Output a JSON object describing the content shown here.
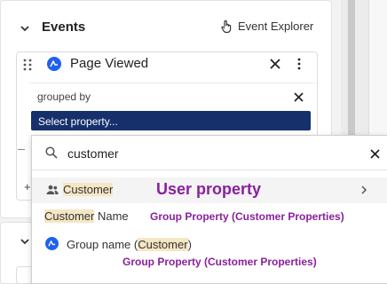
{
  "events_panel": {
    "title": "Events",
    "explorer_label": "Event Explorer",
    "event": {
      "name": "Page Viewed",
      "grouped_by_label": "grouped by",
      "select_property_label": "Select property..."
    },
    "add_label": "+"
  },
  "dropdown": {
    "search_value": "customer",
    "search_placeholder": "",
    "items": [
      {
        "label_match": "Customer",
        "label_rest": "",
        "annotation": "User property",
        "icon": "user-group-icon"
      },
      {
        "label_match": "Customer",
        "label_rest": " Name",
        "annotation": "Group Property (Customer Properties)"
      },
      {
        "label_prefix": "Group name (",
        "label_match": "Customer",
        "label_suffix": ")",
        "annotation": "Group Property (Customer Properties)",
        "icon": "amplitude-icon"
      }
    ]
  },
  "colors": {
    "select_bg": "#15306b",
    "annotation": "#8a1f9e",
    "highlight": "#f5e6c4",
    "amplitude_blue": "#1e61f0"
  }
}
